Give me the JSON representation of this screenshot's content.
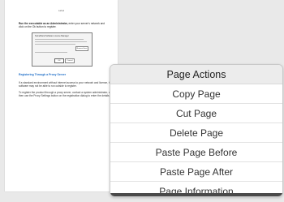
{
  "document": {
    "header": "Label",
    "intro_bold": "Run the executable as an Administrator,",
    "intro_rest": " enter your server's network and click on the Ok button to register.",
    "dialog": {
      "title": "SomeBrand Software License Manager",
      "browse_label": "Browse Here",
      "ok_label": "OK",
      "cancel_label": "Cancel"
    },
    "section_heading": "Registering Through a Proxy Server",
    "paragraph_1": "If a standard environment without internet access to your network and license, the software may not be able to run outside to register.",
    "paragraph_2": "To register the product through a proxy server, contact a system administrator, and then use the Proxy Settings button on the registration dialog to enter the details."
  },
  "context_menu": {
    "title": "Page Actions",
    "items": [
      "Copy Page",
      "Cut Page",
      "Delete Page",
      "Paste Page Before",
      "Paste Page After",
      "Page Information"
    ]
  }
}
